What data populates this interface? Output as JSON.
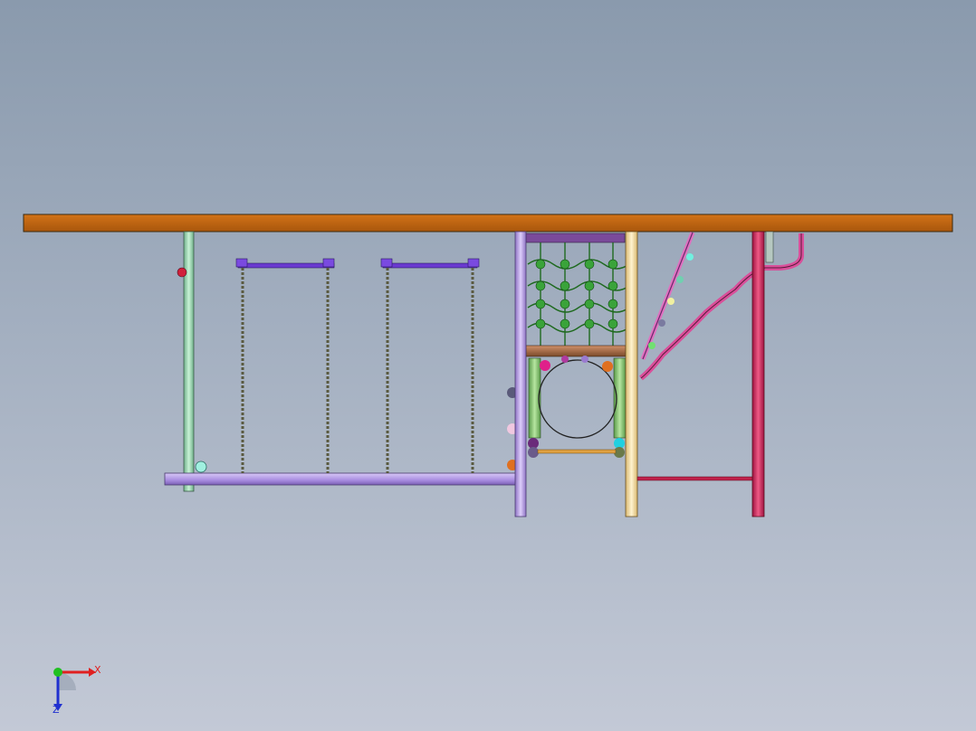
{
  "viewport": {
    "background_top": "#8a9aad",
    "background_bottom": "#c3c9d6"
  },
  "model": {
    "colors": {
      "roof": "#c0640f",
      "post_green": "#a7e0c0",
      "post_purple": "#c4a8f0",
      "post_cream": "#fbe6b0",
      "post_red": "#d4245a",
      "beam_purple": "#b49ae6",
      "swing_bar": "#6a3ad0",
      "chain": "#5a5a40",
      "net": "#2b8a2b",
      "slide": "#e070c0",
      "spiral": "#d94f9a"
    }
  },
  "triad": {
    "x_label": "X",
    "z_label": "Z",
    "x_color": "#e02020",
    "y_color": "#20c020",
    "z_color": "#2030d0"
  }
}
